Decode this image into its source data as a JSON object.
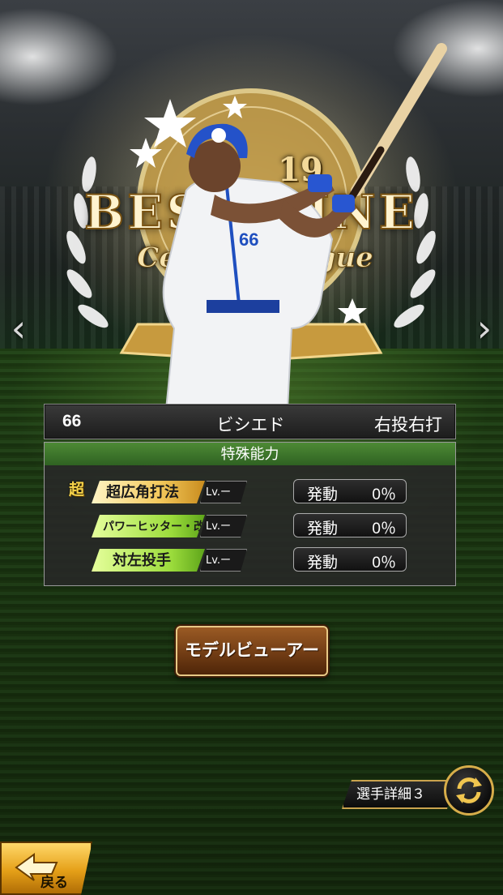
{
  "emblem": {
    "year": "19",
    "title": "BEST NINE",
    "subtitle": "Central League"
  },
  "player": {
    "number": "66",
    "name": "ビシエド",
    "handedness": "右投右打",
    "jersey_number": "66"
  },
  "abilities": {
    "header": "特殊能力",
    "items": [
      {
        "label": "超広角打法",
        "prefix": "超",
        "level": "Lv.ー",
        "status": "発動",
        "rate": "0％",
        "tier": "gold"
      },
      {
        "label": "パワーヒッター・改",
        "level": "Lv.ー",
        "status": "発動",
        "rate": "0％",
        "tier": "green"
      },
      {
        "label": "対左投手",
        "level": "Lv.ー",
        "status": "発動",
        "rate": "0％",
        "tier": "green"
      }
    ]
  },
  "buttons": {
    "model_viewer": "モデルビューアー",
    "player_detail": "選手詳細３",
    "back": "戻る"
  },
  "nav": {
    "prev": "‹",
    "next": "›"
  },
  "colors": {
    "gold": "#d6ad4a",
    "green_header": "#3f7a2c",
    "button_brown": "#6e3a13"
  }
}
